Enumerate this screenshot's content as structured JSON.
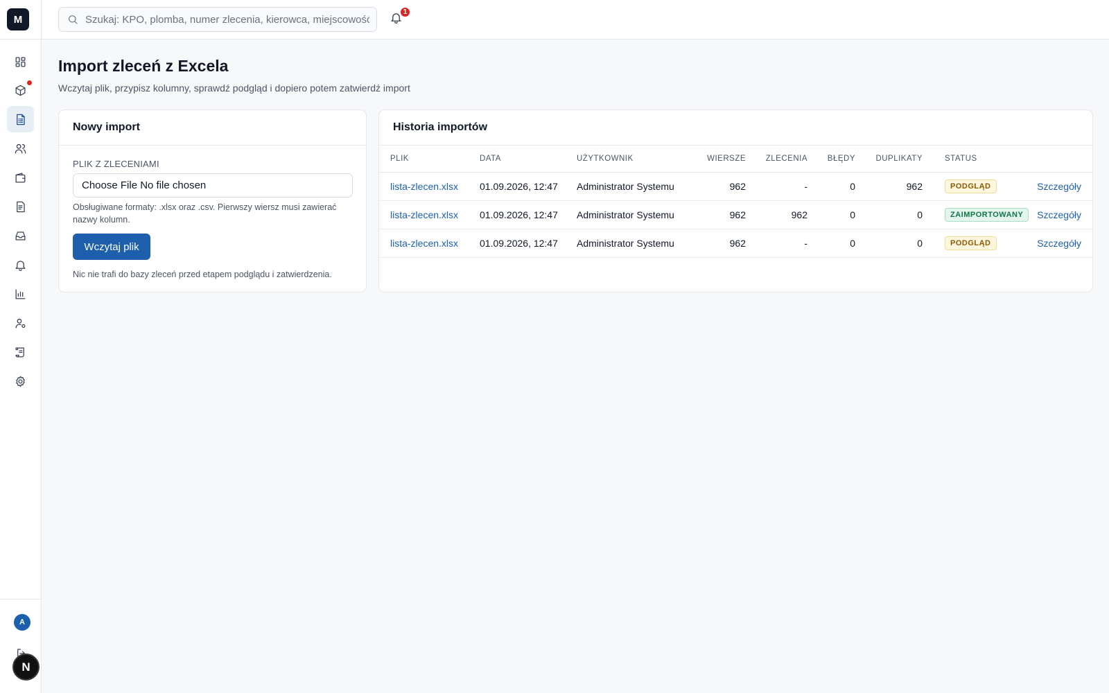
{
  "app": {
    "logo_letter": "M"
  },
  "sidebar": {
    "items": [
      {
        "icon": "dashboard-icon"
      },
      {
        "icon": "package-icon",
        "has_dot": true
      },
      {
        "icon": "document-list-icon",
        "active": true
      },
      {
        "icon": "users-icon"
      },
      {
        "icon": "wallet-icon"
      },
      {
        "icon": "invoice-icon"
      },
      {
        "icon": "inbox-icon"
      },
      {
        "icon": "bell-icon"
      },
      {
        "icon": "chart-icon"
      },
      {
        "icon": "user-settings-icon"
      },
      {
        "icon": "scroll-icon"
      },
      {
        "icon": "gear-icon"
      }
    ],
    "avatar_letter": "A",
    "next_badge_letter": "N"
  },
  "topbar": {
    "search_placeholder": "Szukaj: KPO, plomba, numer zlecenia, kierowca, miejscowość",
    "notifications_count": "1"
  },
  "page": {
    "title": "Import zleceń z Excela",
    "subtitle": "Wczytaj plik, przypisz kolumny, sprawdź podgląd i dopiero potem zatwierdź import"
  },
  "new_import": {
    "title": "Nowy import",
    "field_label": "PLIK Z ZLECENIAMI",
    "file_input_text": "Choose File No file chosen",
    "hint": "Obsługiwane formaty: .xlsx oraz .csv. Pierwszy wiersz musi zawierać nazwy kolumn.",
    "button_label": "Wczytaj plik",
    "note": "Nic nie trafi do bazy zleceń przed etapem podglądu i zatwierdzenia."
  },
  "history": {
    "title": "Historia importów",
    "columns": [
      "PLIK",
      "DATA",
      "UŻYTKOWNIK",
      "WIERSZE",
      "ZLECENIA",
      "BŁĘDY",
      "DUPLIKATY",
      "STATUS"
    ],
    "rows": [
      {
        "file": "lista-zlecen.xlsx",
        "date": "01.09.2026, 12:47",
        "user": "Administrator Systemu",
        "rows": "962",
        "orders": "-",
        "errors": "0",
        "duplicates": "962",
        "status": "PODGLĄD",
        "status_kind": "preview",
        "action": "Szczegóły"
      },
      {
        "file": "lista-zlecen.xlsx",
        "date": "01.09.2026, 12:47",
        "user": "Administrator Systemu",
        "rows": "962",
        "orders": "962",
        "errors": "0",
        "duplicates": "0",
        "status": "ZAIMPORTOWANY",
        "status_kind": "imported",
        "action": "Szczegóły"
      },
      {
        "file": "lista-zlecen.xlsx",
        "date": "01.09.2026, 12:47",
        "user": "Administrator Systemu",
        "rows": "962",
        "orders": "-",
        "errors": "0",
        "duplicates": "0",
        "status": "PODGLĄD",
        "status_kind": "preview",
        "action": "Szczegóły"
      }
    ]
  },
  "colors": {
    "accent": "#1d5fad",
    "badge_red": "#dc2626",
    "preview_pill": "#fef6dd",
    "imported_pill": "#e3f6ec"
  }
}
